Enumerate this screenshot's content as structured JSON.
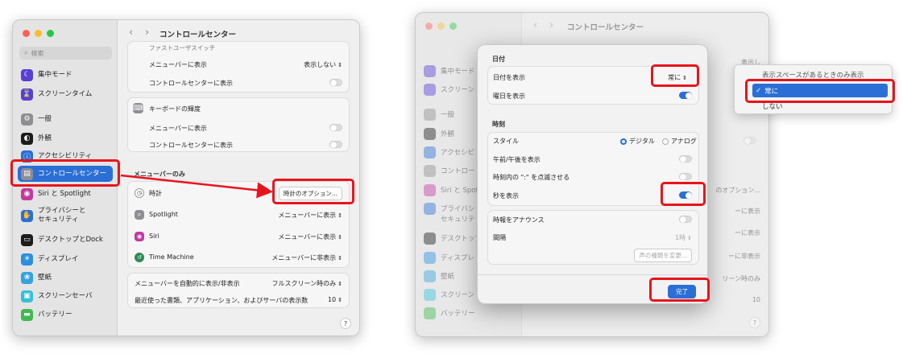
{
  "left": {
    "title": "コントロールセンター",
    "nav_back": "‹",
    "nav_fwd": "›",
    "search_placeholder": "検索",
    "sidebar": [
      {
        "label": "集中モード",
        "color": "#5a3fd4",
        "glyph": "☾"
      },
      {
        "label": "スクリーンタイム",
        "color": "#5a3fd4",
        "glyph": "⌛"
      },
      {
        "label": "一般",
        "color": "#8e8e93",
        "glyph": "⚙"
      },
      {
        "label": "外観",
        "color": "#1c1c1e",
        "glyph": "◐"
      },
      {
        "label": "アクセシビリティ",
        "color": "#2b6fd6",
        "glyph": "ⓘ"
      },
      {
        "label": "コントロールセンター",
        "color": "#8e8e93",
        "glyph": "▤"
      },
      {
        "label": "Siri と Spotlight",
        "color": "#c2399f",
        "glyph": "◉"
      },
      {
        "label": "プライバシーと\nセキュリティ",
        "color": "#2b6fd6",
        "glyph": "✋"
      },
      {
        "label": "デスクトップとDock",
        "color": "#1c1c1e",
        "glyph": "▭"
      },
      {
        "label": "ディスプレイ",
        "color": "#2b8fe0",
        "glyph": "☀"
      },
      {
        "label": "壁紙",
        "color": "#34a3e0",
        "glyph": "❀"
      },
      {
        "label": "スクリーンセーバ",
        "color": "#34c0d8",
        "glyph": "▣"
      },
      {
        "label": "バッテリー",
        "color": "#3fb950",
        "glyph": "▬"
      }
    ],
    "top_partial": "ファストユーザスイッチ",
    "rows_a": [
      {
        "label": "メニューバーに表示",
        "value": "表示しない"
      },
      {
        "label": "コントロールセンターに表示",
        "value": ""
      }
    ],
    "keyboard_title": "キーボードの輝度",
    "rows_b": [
      {
        "label": "メニューバーに表示"
      },
      {
        "label": "コントロールセンターに表示"
      }
    ],
    "menubar_only": "メニューバーのみ",
    "clock_label": "時計",
    "clock_button": "時計のオプション...",
    "spotlight_label": "Spotlight",
    "spotlight_value": "メニューバーに表示",
    "siri_label": "Siri",
    "siri_value": "メニューバーに表示",
    "tm_label": "Time Machine",
    "tm_value": "メニューバーに非表示",
    "autohide_label": "メニューバーを自動的に表示/非表示",
    "autohide_value": "フルスクリーン時のみ",
    "recent_label": "最近使った書類、アプリケーション、およびサーバの表示数",
    "recent_value": "10",
    "help": "?"
  },
  "right": {
    "title": "コントロールセンター",
    "bg_sidebar": [
      "集中モード",
      "スクリーン",
      "一般",
      "外観",
      "アクセシビ",
      "コントロー",
      "Siri と Spot",
      "プライバシ",
      "セキュリテ",
      "デスクトップ",
      "ディスプレ",
      "壁紙",
      "スクリーン",
      "バッテリー"
    ],
    "bg_right_values": [
      "表示し",
      "のオプション...",
      "ーに表示",
      "ーに表示",
      "ーに非表示",
      "リーン時のみ",
      "10"
    ],
    "dialog": {
      "date_header": "日付",
      "show_date_label": "日付を表示",
      "show_date_value": "常に",
      "show_weekday_label": "曜日を表示",
      "time_header": "時刻",
      "style_label": "スタイル",
      "style_digital": "デジタル",
      "style_analog": "アナログ",
      "ampm_label": "午前/午後を表示",
      "blink_label": "時刻内の \":\" を点滅させる",
      "seconds_label": "秒を表示",
      "announce_label": "時報をアナウンス",
      "interval_label": "間隔",
      "interval_value": "1時",
      "voice_button": "声の種類を変更...",
      "done": "完了"
    },
    "popup": {
      "opt1": "表示スペースがあるときのみ表示",
      "opt2": "常に",
      "opt3": "しない",
      "check": "✓"
    }
  },
  "colors": {
    "accent": "#2b6fd6",
    "highlight": "#e8141b"
  }
}
